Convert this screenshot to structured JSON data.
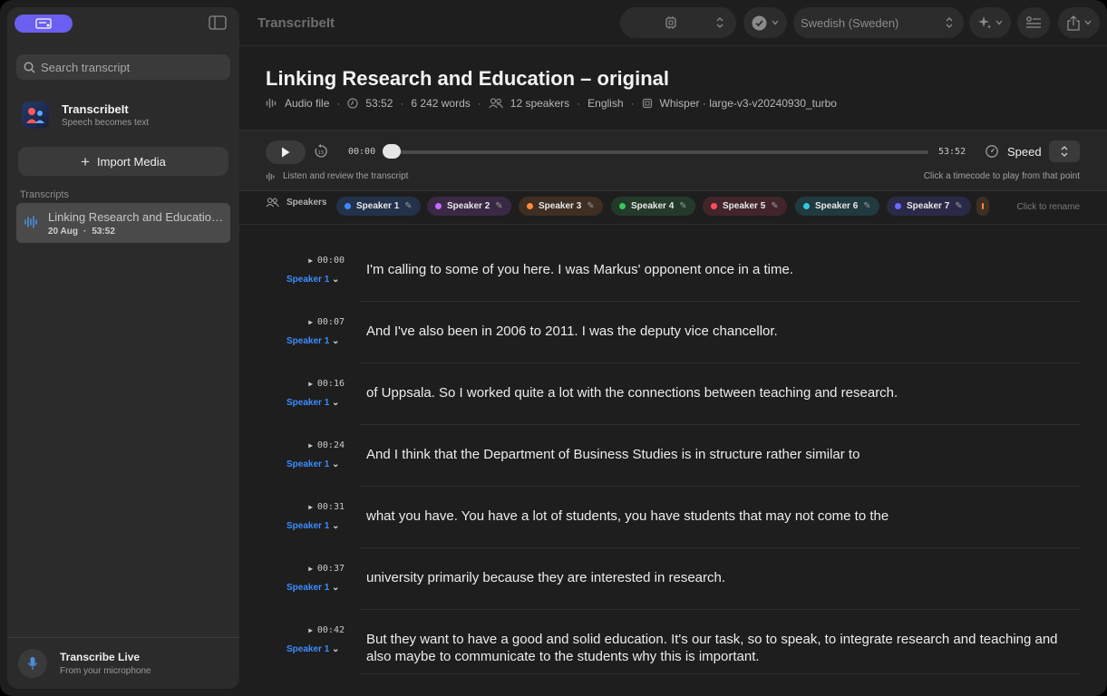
{
  "sidebar": {
    "search_placeholder": "Search transcript",
    "app_name": "TranscribeIt",
    "app_tagline": "Speech becomes text",
    "import_label": "Import Media",
    "section_label": "Transcripts",
    "transcripts": [
      {
        "title": "Linking Research and Education – original",
        "date": "20 Aug",
        "duration": "53:52"
      }
    ],
    "live_title": "Transcribe Live",
    "live_subtitle": "From your microphone"
  },
  "toolbar": {
    "title": "TranscribeIt",
    "language": "Swedish (Sweden)"
  },
  "document": {
    "title": "Linking Research and Education – original",
    "source": "Audio file",
    "duration": "53:52",
    "words": "6 242 words",
    "speakers": "12 speakers",
    "language": "English",
    "model": "Whisper · large-v3-v20240930_turbo"
  },
  "player": {
    "current_time": "00:00",
    "total_time": "53:52",
    "progress": 0,
    "speed_label": "Speed",
    "hint_left": "Listen and review the transcript",
    "hint_right": "Click a timecode to play from that point"
  },
  "speakers_bar": {
    "label": "Speakers",
    "rename_hint": "Click to rename",
    "speakers": [
      {
        "name": "Speaker 1",
        "color": "#3b8cff",
        "bg": "#23324a"
      },
      {
        "name": "Speaker 2",
        "color": "#c46bff",
        "bg": "#3a2944"
      },
      {
        "name": "Speaker 3",
        "color": "#ff8a3d",
        "bg": "#3f2e22"
      },
      {
        "name": "Speaker 4",
        "color": "#34c759",
        "bg": "#233a2a"
      },
      {
        "name": "Speaker 5",
        "color": "#ff4d5e",
        "bg": "#42252a"
      },
      {
        "name": "Speaker 6",
        "color": "#36c8e0",
        "bg": "#203a3f"
      },
      {
        "name": "Speaker 7",
        "color": "#6a6aff",
        "bg": "#2a2a48"
      }
    ]
  },
  "segments": [
    {
      "time": "00:00",
      "speaker": "Speaker 1",
      "text": "I'm calling to some of you here. I was Markus' opponent once in a time."
    },
    {
      "time": "00:07",
      "speaker": "Speaker 1",
      "text": "And I've also been in 2006 to 2011. I was the deputy vice chancellor."
    },
    {
      "time": "00:16",
      "speaker": "Speaker 1",
      "text": "of Uppsala. So I worked quite a lot with the connections between teaching and research."
    },
    {
      "time": "00:24",
      "speaker": "Speaker 1",
      "text": "And I think that the Department of Business Studies is in structure rather similar to"
    },
    {
      "time": "00:31",
      "speaker": "Speaker 1",
      "text": "what you have. You have a lot of students, you have students that may not come to the"
    },
    {
      "time": "00:37",
      "speaker": "Speaker 1",
      "text": "university primarily because they are interested in research."
    },
    {
      "time": "00:42",
      "speaker": "Speaker 1",
      "text": "But they want to have a good and solid education. It's our task, so to speak, to integrate research and teaching and also maybe to communicate to the students why this is important."
    }
  ]
}
